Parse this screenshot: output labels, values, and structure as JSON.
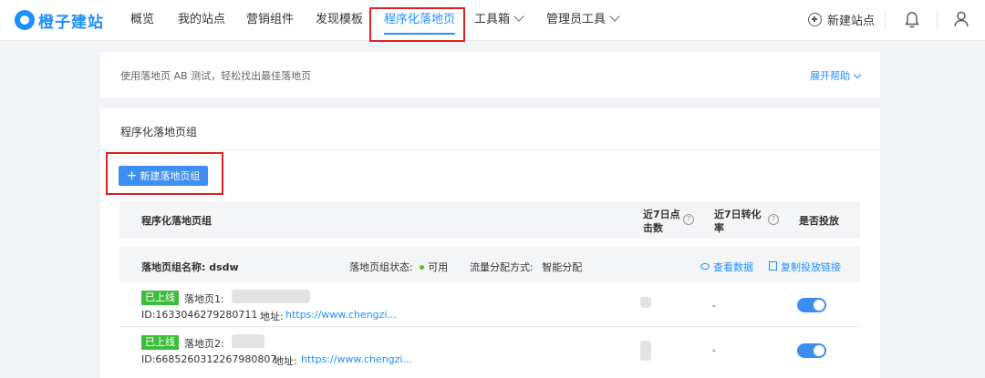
{
  "brand": {
    "logo_text": "橙子建站",
    "color": "#1e8fff"
  },
  "nav": {
    "items": [
      {
        "label": "概览"
      },
      {
        "label": "我的站点"
      },
      {
        "label": "营销组件"
      },
      {
        "label": "发现模板"
      },
      {
        "label": "程序化落地页",
        "active": true
      },
      {
        "label": "工具箱",
        "dropdown": true
      },
      {
        "label": "管理员工具",
        "dropdown": true
      }
    ],
    "new_site_label": "新建站点",
    "icons": [
      "plus-circle-icon",
      "bell-icon",
      "user-icon"
    ]
  },
  "help_bar": {
    "text": "使用落地页 AB 测试，轻松找出最佳落地页",
    "expand_label": "展开帮助"
  },
  "section": {
    "title": "程序化落地页组",
    "new_group_button": "新建落地页组"
  },
  "table": {
    "headers": {
      "name": "程序化落地页组",
      "clicks_line1": "近7日点",
      "clicks_line2": "击数",
      "conversion_line1": "近7日转化",
      "conversion_line2": "率",
      "delivery": "是否投放"
    },
    "group": {
      "name_label": "落地页组名称:",
      "name_value": "dsdw",
      "status_label": "落地页组状态:",
      "status_value": "可用",
      "traffic_label": "流量分配方式:",
      "traffic_value": "智能分配",
      "view_data": "查看数据",
      "copy_link": "复制投放链接"
    },
    "rows": [
      {
        "tag": "已上线",
        "name_label": "落地页1:",
        "id": "ID:1633046279280711",
        "address_label": "地址:",
        "address": "https://www.chengzi...",
        "conversion": "-",
        "delivery_on": true
      },
      {
        "tag": "已上线",
        "name_label": "落地页2:",
        "id": "ID:6685260312267980807",
        "address_label": "地址:",
        "address": "https://www.chengzi...",
        "conversion": "-",
        "delivery_on": true
      }
    ]
  },
  "colors": {
    "primary": "#3d8ef0",
    "highlight_box": "#e02020",
    "online_tag": "#3dbd3a"
  }
}
